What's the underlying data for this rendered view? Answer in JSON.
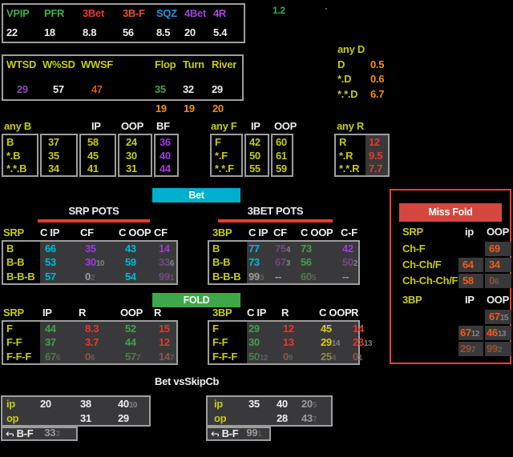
{
  "palette": {
    "label_yellow": "#c3cc17",
    "stat_green": "#3fae49",
    "stat_red": "#e5382c",
    "stat_orange_red": "#e0522a",
    "stat_blue": "#1e96e8",
    "stat_purple": "#9b45d8",
    "stat_magenta": "#ab45d8",
    "orange": "#f29111",
    "wtsd_purple": "#9547b8",
    "cyan": "#00b9d8",
    "violet": "#a238e0",
    "violet_dim": "#6e4b85",
    "green": "#43a047",
    "green_dim": "#4e7a4e",
    "red_dim": "#93524a",
    "yellow_value": "#d6ce1a",
    "yellow_dim": "#8f8a48",
    "miss_orange": "#ee5a1c",
    "miss_orange_dim": "#96502c",
    "gray": "#9a9a9a",
    "cell_bg": "#39393b",
    "border_gray": "#9e9e9e",
    "bet_button_bg": "#00aecd",
    "fold_button_bg": "#3da84a",
    "miss_fold_border": "#e8402f",
    "miss_fold_header_bg": "#d4473e",
    "title_bar_red": "#ef3b2d"
  },
  "preflop": {
    "headers": [
      "VPIP",
      "PFR",
      "3Bet",
      "3B-F",
      "SQZ",
      "4Bet",
      "4R"
    ],
    "values": [
      "22",
      "18",
      "8.8",
      "56",
      "8.5",
      "20",
      "5.4"
    ],
    "note": "1.2",
    "dot": "."
  },
  "showdown": {
    "headers": [
      "WTSD",
      "W%SD",
      "WWSF",
      "Flop",
      "Turn",
      "River"
    ],
    "values": [
      "29",
      "57",
      "47",
      "35",
      "32",
      "29"
    ],
    "sub_values": [
      "19",
      "19",
      "20"
    ]
  },
  "any_d": {
    "title": "any D",
    "rows": [
      {
        "label": "D",
        "value": "0.5"
      },
      {
        "label": "*.D",
        "value": "0.6"
      },
      {
        "label": "*.*.D",
        "value": "6.7"
      }
    ]
  },
  "any_b": {
    "title": "any B",
    "headers": [
      "IP",
      "OOP",
      "BF"
    ],
    "labels": [
      "B",
      "*.B",
      "*.*.B"
    ],
    "total": [
      "37",
      "35",
      "34"
    ],
    "ip": [
      "58",
      "45",
      "41"
    ],
    "oop": [
      "24",
      "30",
      "31"
    ],
    "bf": [
      "36",
      "40",
      "44"
    ]
  },
  "any_f": {
    "title": "any F",
    "headers": [
      "IP",
      "OOP"
    ],
    "labels": [
      "F",
      "*.F",
      "*.*.F"
    ],
    "ip": [
      "42",
      "50",
      "55"
    ],
    "oop": [
      "60",
      "61",
      "59"
    ]
  },
  "any_r": {
    "title": "any R",
    "labels": [
      "R",
      "*.R",
      "*.*.R"
    ],
    "values": [
      "12",
      "9.5",
      "7.7"
    ]
  },
  "bet_button": "Bet",
  "fold_button": "FOLD",
  "srp_pots": {
    "title": "SRP POTS",
    "corner": "SRP",
    "headers": [
      "C IP",
      "CF",
      "C OOP",
      "CF"
    ],
    "rows": [
      {
        "label": "B",
        "c1": "66",
        "c2": "35",
        "c3": "43",
        "c4": "14"
      },
      {
        "label": "B-B",
        "c1": "53",
        "c2": "30",
        "c2s": "10",
        "c3": "59",
        "c4": "33",
        "c4s": "6"
      },
      {
        "label": "B-B-B",
        "c1": "57",
        "c2": "0",
        "c2s": "2",
        "c3": "54",
        "c4": "99",
        "c4s": "1"
      }
    ]
  },
  "threebet_pots": {
    "title": "3BET POTS",
    "corner": "3BP",
    "headers": [
      "C IP",
      "CF",
      "C OOP",
      "C-F"
    ],
    "rows": [
      {
        "label": "B",
        "c1": "77",
        "c2": "75",
        "c2s": "4",
        "c3": "73",
        "c4": "42"
      },
      {
        "label": "B-B",
        "c1": "73",
        "c2": "67",
        "c2s": "3",
        "c3": "56",
        "c4": "50",
        "c4s": "2"
      },
      {
        "label": "B-B-B",
        "c1": "99",
        "c1s": "3",
        "c2": "--",
        "c3": "60",
        "c3s": "5",
        "c4": "--"
      }
    ]
  },
  "srp_fold": {
    "corner": "SRP",
    "headers": [
      "IP",
      "R",
      "OOP",
      "R"
    ],
    "rows": [
      {
        "label": "F",
        "c1": "44",
        "c2": "8.3",
        "c3": "52",
        "c4": "15"
      },
      {
        "label": "F-F",
        "c1": "37",
        "c2": "3.7",
        "c3": "44",
        "c4": "12"
      },
      {
        "label": "F-F-F",
        "c1": "67",
        "c1s": "6",
        "c2": "0",
        "c2s": "6",
        "c3": "57",
        "c3s": "7",
        "c4": "14",
        "c4s": "7"
      }
    ]
  },
  "threebet_fold": {
    "corner": "3BP",
    "headers": [
      "C IP",
      "R",
      "C OOP",
      "R"
    ],
    "rows": [
      {
        "label": "F",
        "c1": "29",
        "c2": "12",
        "c3": "45",
        "c4": "14"
      },
      {
        "label": "F-F",
        "c1": "30",
        "c2": "13",
        "c3": "29",
        "c3s": "14",
        "c4": "23",
        "c4s": "13"
      },
      {
        "label": "F-F-F",
        "c1": "50",
        "c1s": "12",
        "c2": "0",
        "c2s": "9",
        "c3": "25",
        "c3s": "4",
        "c4": "0",
        "c4s": "1"
      }
    ]
  },
  "miss_fold": {
    "title": "Miss Fold",
    "srp": {
      "corner": "SRP",
      "headers": [
        "ip",
        "OOP"
      ],
      "rows": [
        {
          "label": "Ch-F",
          "oop": "69"
        },
        {
          "label": "Ch-Ch/F",
          "ip": "64",
          "oop": "34"
        },
        {
          "label": "Ch-Ch-Ch/F",
          "ip": "58",
          "oop": "0",
          "oop_s": "6"
        }
      ]
    },
    "threebet": {
      "corner": "3BP",
      "headers": [
        "IP",
        "OOP"
      ],
      "rows": [
        {
          "oop": "67",
          "oop_s": "15"
        },
        {
          "ip": "67",
          "ip_s": "12",
          "oop": "46",
          "oop_s": "13"
        },
        {
          "ip": "29",
          "ip_s": "7",
          "oop": "99",
          "oop_s": "2"
        }
      ]
    }
  },
  "vs_skip_cb": {
    "title": "Bet vsSkipCb",
    "left": {
      "rows": [
        {
          "label": "ip",
          "c1": "20",
          "c2": "38",
          "c3": "40",
          "c3s": "10"
        },
        {
          "label": "op",
          "c2": "31",
          "c3": "29"
        }
      ],
      "bf_label": "B-F",
      "bf_value": "33",
      "bf_sup": "3"
    },
    "right": {
      "rows": [
        {
          "label": "ip",
          "c1": "35",
          "c2": "40",
          "c3": "20",
          "c3s": "5"
        },
        {
          "label": "op",
          "c2": "28",
          "c3": "43",
          "c3s": "7"
        }
      ],
      "bf_label": "B-F",
      "bf_value": "99",
      "bf_sup": "1"
    }
  }
}
